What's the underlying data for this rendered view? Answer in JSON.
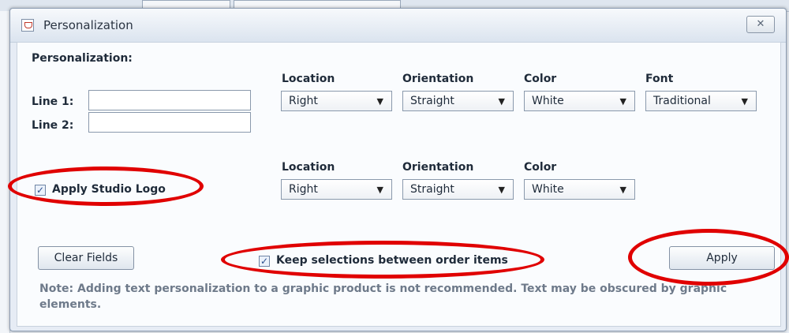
{
  "window": {
    "title": "Personalization",
    "close_icon": "close-icon"
  },
  "section_title": "Personalization:",
  "line1": {
    "label": "Line 1:",
    "value": ""
  },
  "line2": {
    "label": "Line 2:",
    "value": ""
  },
  "text_options": {
    "headers": [
      "Location",
      "Orientation",
      "Color",
      "Font"
    ],
    "values": [
      "Right",
      "Straight",
      "White",
      "Traditional"
    ]
  },
  "logo_options": {
    "headers": [
      "Location",
      "Orientation",
      "Color"
    ],
    "values": [
      "Right",
      "Straight",
      "White"
    ]
  },
  "apply_logo": {
    "label": "Apply Studio Logo",
    "checked": true
  },
  "keep_selections": {
    "label": "Keep selections between order items",
    "checked": true
  },
  "buttons": {
    "clear": "Clear Fields",
    "apply": "Apply"
  },
  "note": "Note: Adding text personalization to a graphic product is not recommended. Text may be obscured by graphic elements.",
  "colors": {
    "annotation": "#e00000"
  }
}
